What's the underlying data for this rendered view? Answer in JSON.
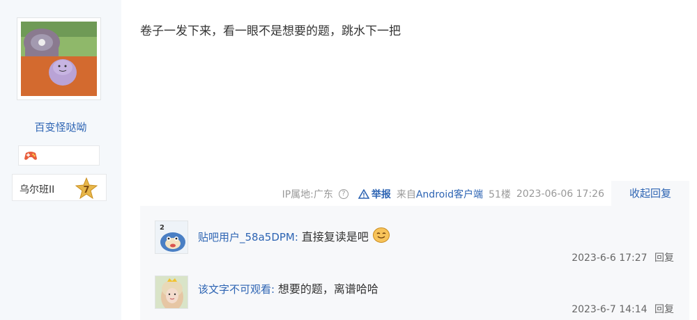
{
  "author": {
    "name": "百变怪哒呦",
    "level_name": "乌尔班II",
    "level_number": "7"
  },
  "post": {
    "content": "卷子一发下来，看一眼不是想要的题，跳水下一把"
  },
  "meta": {
    "ip_label": "IP属地:广东",
    "help_symbol": "?",
    "report_label": "举报",
    "source_prefix": "来自",
    "source_client": "Android客户端",
    "floor": "51楼",
    "timestamp": "2023-06-06 17:26",
    "collapse_label": "收起回复"
  },
  "replies": [
    {
      "user": "贴吧用户_58a5DPM",
      "colon": ":",
      "text": "直接复读是吧",
      "time": "2023-6-6 17:27",
      "reply_label": "回复"
    },
    {
      "user": "该文字不可观看",
      "colon": ":",
      "text": "想要的题，离谱哈哈",
      "time": "2023-6-7 14:14",
      "reply_label": "回复"
    }
  ],
  "colors": {
    "link": "#2d64b3",
    "sidebar_bg": "#f5f8fb",
    "reply_bg": "#f7f8fa"
  }
}
